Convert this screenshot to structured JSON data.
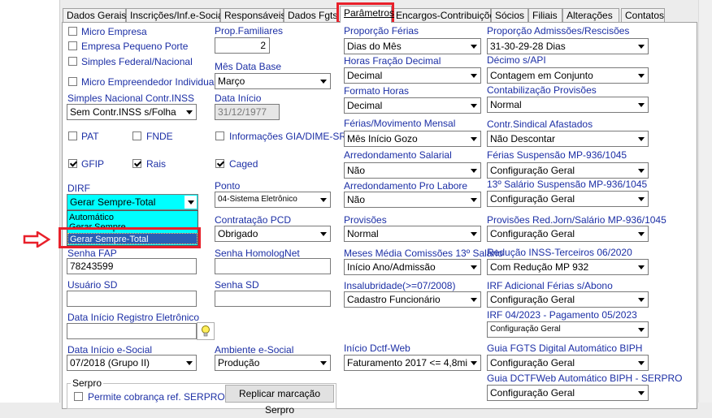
{
  "tabs": [
    "Dados Gerais",
    "Inscrições/Inf.e-Social",
    "Responsáveis",
    "Dados Fgts",
    "Parâmetros",
    "Encargos-Contribuições",
    "Sócios",
    "Filiais",
    "Alterações",
    "Contatos"
  ],
  "col1": {
    "micro_empresa": "Micro Empresa",
    "empresa_pequeno_porte": "Empresa Pequeno Porte",
    "simples_federal": "Simples Federal/Nacional",
    "micro_empreendedor": "Micro Empreendedor Individual",
    "simples_contr_inss_label": "Simples Nacional Contr.INSS",
    "simples_contr_inss_value": "Sem Contr.INSS s/Folha",
    "pat": "PAT",
    "fnde": "FNDE",
    "gfip": "GFIP",
    "rais": "Rais",
    "dirf_label": "DIRF",
    "dirf_value": "Gerar Sempre-Total",
    "dirf_options": [
      "Automático",
      "Gerar Sempre",
      "Gerar Sempre-Total"
    ],
    "senha_fap_label": "Senha FAP",
    "senha_fap_value": "78243599",
    "usuario_sd_label": "Usuário SD",
    "data_inicio_reg_label": "Data Início Registro Eletrônico",
    "data_inicio_esocial_label": "Data Início e-Social",
    "data_inicio_esocial_value": "07/2018 (Grupo II)",
    "serpro_group": "Serpro",
    "permite_cobranca": "Permite cobrança ref. SERPRO"
  },
  "col2": {
    "prop_familiares_label": "Prop.Familiares",
    "prop_familiares_value": "2",
    "mes_data_base_label": "Mês Data Base",
    "mes_data_base_value": "Março",
    "data_inicio_label": "Data Início",
    "data_inicio_value": "31/12/1977",
    "info_gia": "Informações GIA/DIME-SRF",
    "caged": "Caged",
    "ponto_label": "Ponto",
    "ponto_value": "04-Sistema Eletrônico",
    "contratacao_pcd_label": "Contratação PCD",
    "contratacao_pcd_value": "Obrigado",
    "senha_homolognet_label": "Senha HomologNet",
    "senha_sd_label": "Senha SD",
    "ambiente_esocial_label": "Ambiente e-Social",
    "ambiente_esocial_value": "Produção",
    "replicar_button": "Replicar marcação Serpro"
  },
  "col3": {
    "proporcao_ferias_label": "Proporção Férias",
    "proporcao_ferias_value": "Dias do Mês",
    "horas_fracao_label": "Horas Fração Decimal",
    "horas_fracao_value": "Decimal",
    "formato_horas_label": "Formato Horas",
    "formato_horas_value": "Decimal",
    "ferias_mov_label": "Férias/Movimento Mensal",
    "ferias_mov_value": "Mês Início Gozo",
    "arred_salarial_label": "Arredondamento Salarial",
    "arred_salarial_value": "Não",
    "arred_pro_labore_label": "Arredondamento Pro Labore",
    "arred_pro_labore_value": "Não",
    "provisoes_label": "Provisões",
    "provisoes_value": "Normal",
    "meses_media_label": "Meses Média Comissões 13º Salário",
    "meses_media_value": "Início Ano/Admissão",
    "insalubridade_label": "Insalubridade(>=07/2008)",
    "insalubridade_value": "Cadastro Funcionário",
    "inicio_dctf_label": "Início Dctf-Web",
    "inicio_dctf_value": "Faturamento 2017 <= 4,8mi"
  },
  "col4": {
    "proporcao_admissoes_label": "Proporção Admissões/Rescisões",
    "proporcao_admissoes_value": "31-30-29-28 Dias",
    "decimo_api_label": "Décimo s/API",
    "decimo_api_value": "Contagem em Conjunto",
    "contab_provisoes_label": "Contabilização Provisões",
    "contab_provisoes_value": "Normal",
    "contr_sindical_label": "Contr.Sindical Afastados",
    "contr_sindical_value": "Não Descontar",
    "ferias_suspensao_label": "Férias Suspensão MP-936/1045",
    "ferias_suspensao_value": "Configuração Geral",
    "decimo_suspensao_label": "13º Salário Suspensão MP-936/1045",
    "decimo_suspensao_value": "Configuração Geral",
    "provisoes_red_label": "Provisões Red.Jorn/Salário MP-936/1045",
    "provisoes_red_value": "Configuração Geral",
    "reducao_inss_label": "Redução INSS-Terceiros 06/2020",
    "reducao_inss_value": "Com Redução MP 932",
    "irf_adicional_label": "IRF Adicional Férias s/Abono",
    "irf_adicional_value": "Configuração Geral",
    "irf_04_label": "IRF 04/2023 - Pagamento 05/2023",
    "irf_04_value": "Configuração Geral",
    "guia_fgts_label": "Guia FGTS Digital Automático BIPH",
    "guia_fgts_value": "Configuração Geral",
    "guia_dctf_label": "Guia DCTFWeb Automático BIPH - SERPRO",
    "guia_dctf_value": "Configuração Geral"
  },
  "colors": {
    "label_blue": "#1c2fa5",
    "highlight_red": "#e8202a",
    "dropdown_cyan": "#00ffff",
    "selection_blue": "#2b5fb5"
  }
}
